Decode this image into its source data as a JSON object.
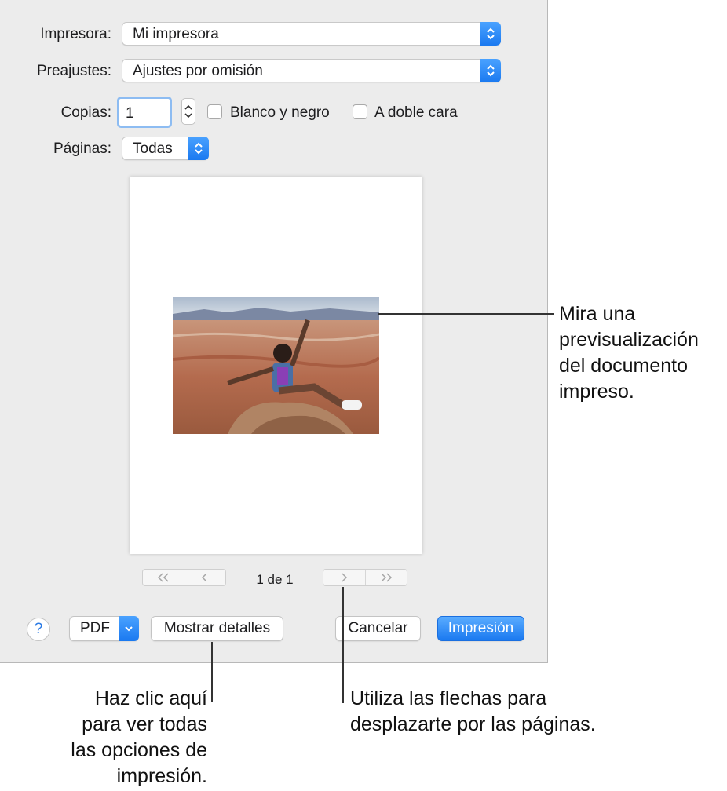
{
  "form": {
    "printer_label": "Impresora:",
    "printer_value": "Mi impresora",
    "presets_label": "Preajustes:",
    "presets_value": "Ajustes por omisión",
    "copies_label": "Copias:",
    "copies_value": "1",
    "bw_label": "Blanco y negro",
    "duplex_label": "A doble cara",
    "pages_label": "Páginas:",
    "pages_value": "Todas"
  },
  "preview": {
    "page_indicator": "1 de 1"
  },
  "buttons": {
    "help": "?",
    "pdf": "PDF",
    "details": "Mostrar detalles",
    "cancel": "Cancelar",
    "print": "Impresión"
  },
  "callouts": {
    "preview_lines": [
      "Mira una",
      "previsualización",
      "del documento",
      "impreso."
    ],
    "details_lines": [
      "Haz clic aquí",
      "para ver todas",
      "las opciones de",
      "impresión."
    ],
    "arrows_lines": [
      "Utiliza las flechas para",
      "desplazarte por las páginas."
    ]
  },
  "colors": {
    "accent": "#1a79f0",
    "dialog_bg": "#ececec"
  }
}
